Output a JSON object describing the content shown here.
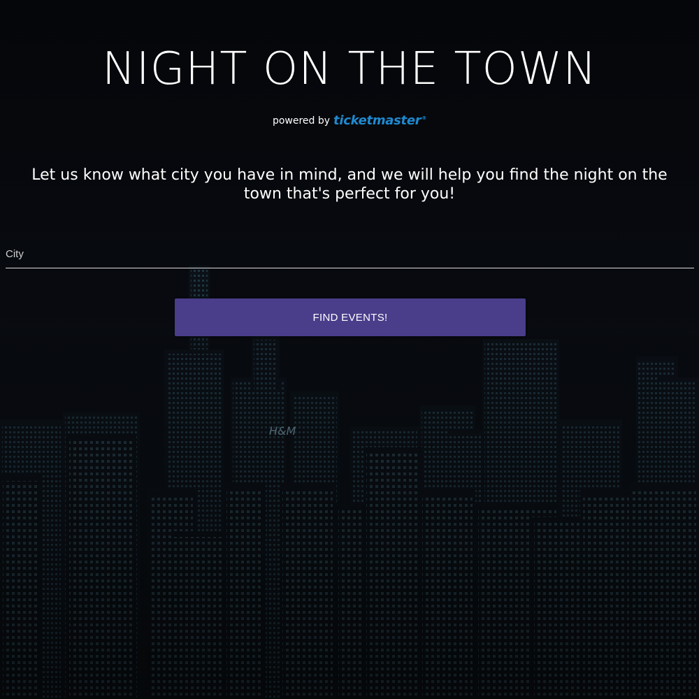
{
  "page": {
    "title": "NIGHT ON THE TOWN",
    "powered_by_label": "powered by",
    "powered_by_brand": "ticketmaster",
    "powered_by_reg": "®",
    "intro_text": "Let us know what city you have in mind, and we will help you find the night on the town that's perfect for you!"
  },
  "search": {
    "city_placeholder": "City",
    "city_value": "",
    "submit_label": "FIND EVENTS!"
  },
  "background": {
    "icon": "city-skyline-image",
    "sign_text": "H&M"
  },
  "colors": {
    "page_bg": "#060709",
    "text": "#ffffff",
    "button_bg": "#4a3d8a",
    "brand_blue": "#1f8ad0",
    "input_line": "#dcdcdc"
  }
}
